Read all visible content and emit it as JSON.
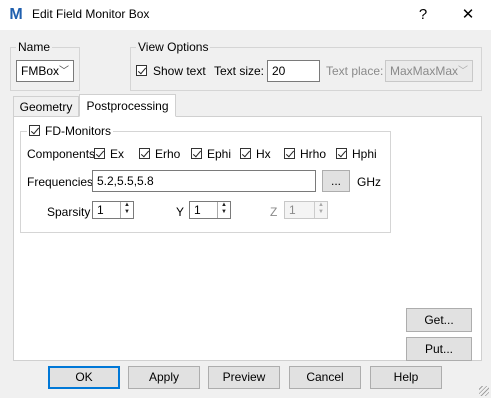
{
  "window": {
    "title": "Edit Field Monitor Box",
    "help_glyph": "?",
    "close_glyph": "✕",
    "app_icon_glyph": "M"
  },
  "name_group": {
    "label": "Name",
    "value": "FMBox"
  },
  "view_options": {
    "label": "View Options",
    "show_text_label": "Show text",
    "show_text_checked": true,
    "text_size_label": "Text size:",
    "text_size_value": "20",
    "text_place_label": "Text place:",
    "text_place_value": "MaxMaxMax"
  },
  "tabs": [
    {
      "label": "Geometry",
      "active": false
    },
    {
      "label": "Postprocessing",
      "active": true
    }
  ],
  "postprocessing": {
    "fd_monitors_label": "FD-Monitors",
    "components_label": "Components",
    "components": [
      {
        "label": "Ex",
        "checked": true
      },
      {
        "label": "Erho",
        "checked": true
      },
      {
        "label": "Ephi",
        "checked": true
      },
      {
        "label": "Hx",
        "checked": true
      },
      {
        "label": "Hrho",
        "checked": true
      },
      {
        "label": "Hphi",
        "checked": true
      }
    ],
    "frequencies_label": "Frequencies",
    "frequencies_value": "5.2,5.5,5.8",
    "browse_label": "...",
    "unit": "GHz",
    "sparsity_label": "Sparsity",
    "sparsity_value": "1",
    "y_label": "Y",
    "y_value": "1",
    "z_label": "Z",
    "z_value": "1"
  },
  "side_buttons": {
    "get": "Get...",
    "put": "Put..."
  },
  "footer_buttons": {
    "ok": "OK",
    "apply": "Apply",
    "preview": "Preview",
    "cancel": "Cancel",
    "help": "Help"
  },
  "icons": {
    "spin_up": "▲",
    "spin_down": "▼",
    "chevron": "﹀"
  }
}
